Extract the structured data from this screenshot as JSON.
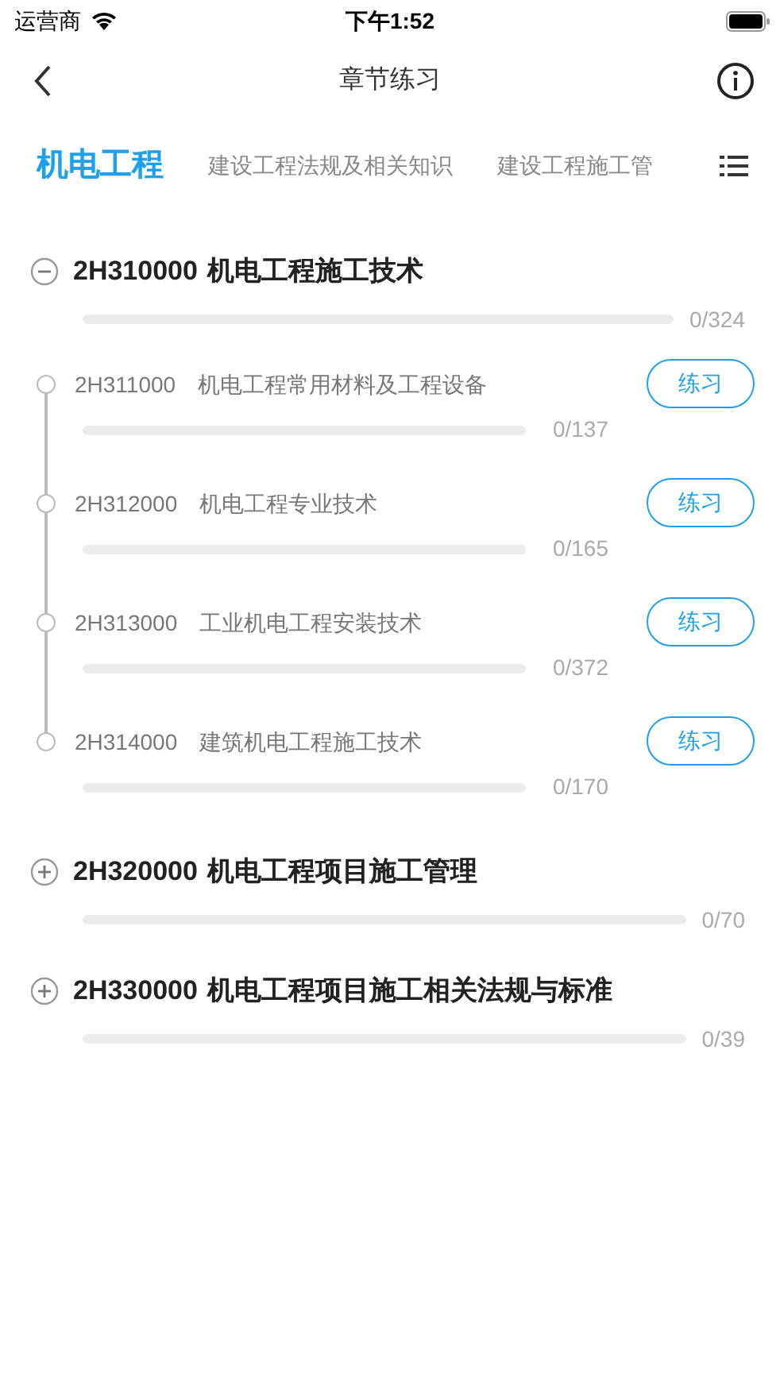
{
  "status_bar": {
    "carrier": "运营商",
    "time": "下午1:52"
  },
  "nav": {
    "title": "章节练习"
  },
  "tabs": [
    {
      "label": "机电工程",
      "selected": true
    },
    {
      "label": "建设工程法规及相关知识",
      "selected": false
    },
    {
      "label": "建设工程施工管",
      "selected": false
    }
  ],
  "chapters": [
    {
      "code": "2H310000",
      "title": "机电工程施工技术",
      "expanded": true,
      "level": 0,
      "count": "0/324",
      "sections": [
        {
          "code": "2H311000",
          "title": "机电工程常用材料及工程设备",
          "level": 0,
          "count": "0/137",
          "button": "练习"
        },
        {
          "code": "2H312000",
          "title": "机电工程专业技术",
          "level": 0,
          "count": "0/165",
          "button": "练习"
        },
        {
          "code": "2H313000",
          "title": "工业机电工程安装技术",
          "level": 0,
          "count": "0/372",
          "button": "练习"
        },
        {
          "code": "2H314000",
          "title": "建筑机电工程施工技术",
          "level": 0,
          "count": "0/170",
          "button": "练习"
        }
      ]
    },
    {
      "code": "2H320000",
      "title": "机电工程项目施工管理",
      "expanded": false,
      "level": 0,
      "count": "0/70"
    },
    {
      "code": "2H330000",
      "title": "机电工程项目施工相关法规与标准",
      "expanded": false,
      "level": 0,
      "count": "0/39"
    }
  ]
}
